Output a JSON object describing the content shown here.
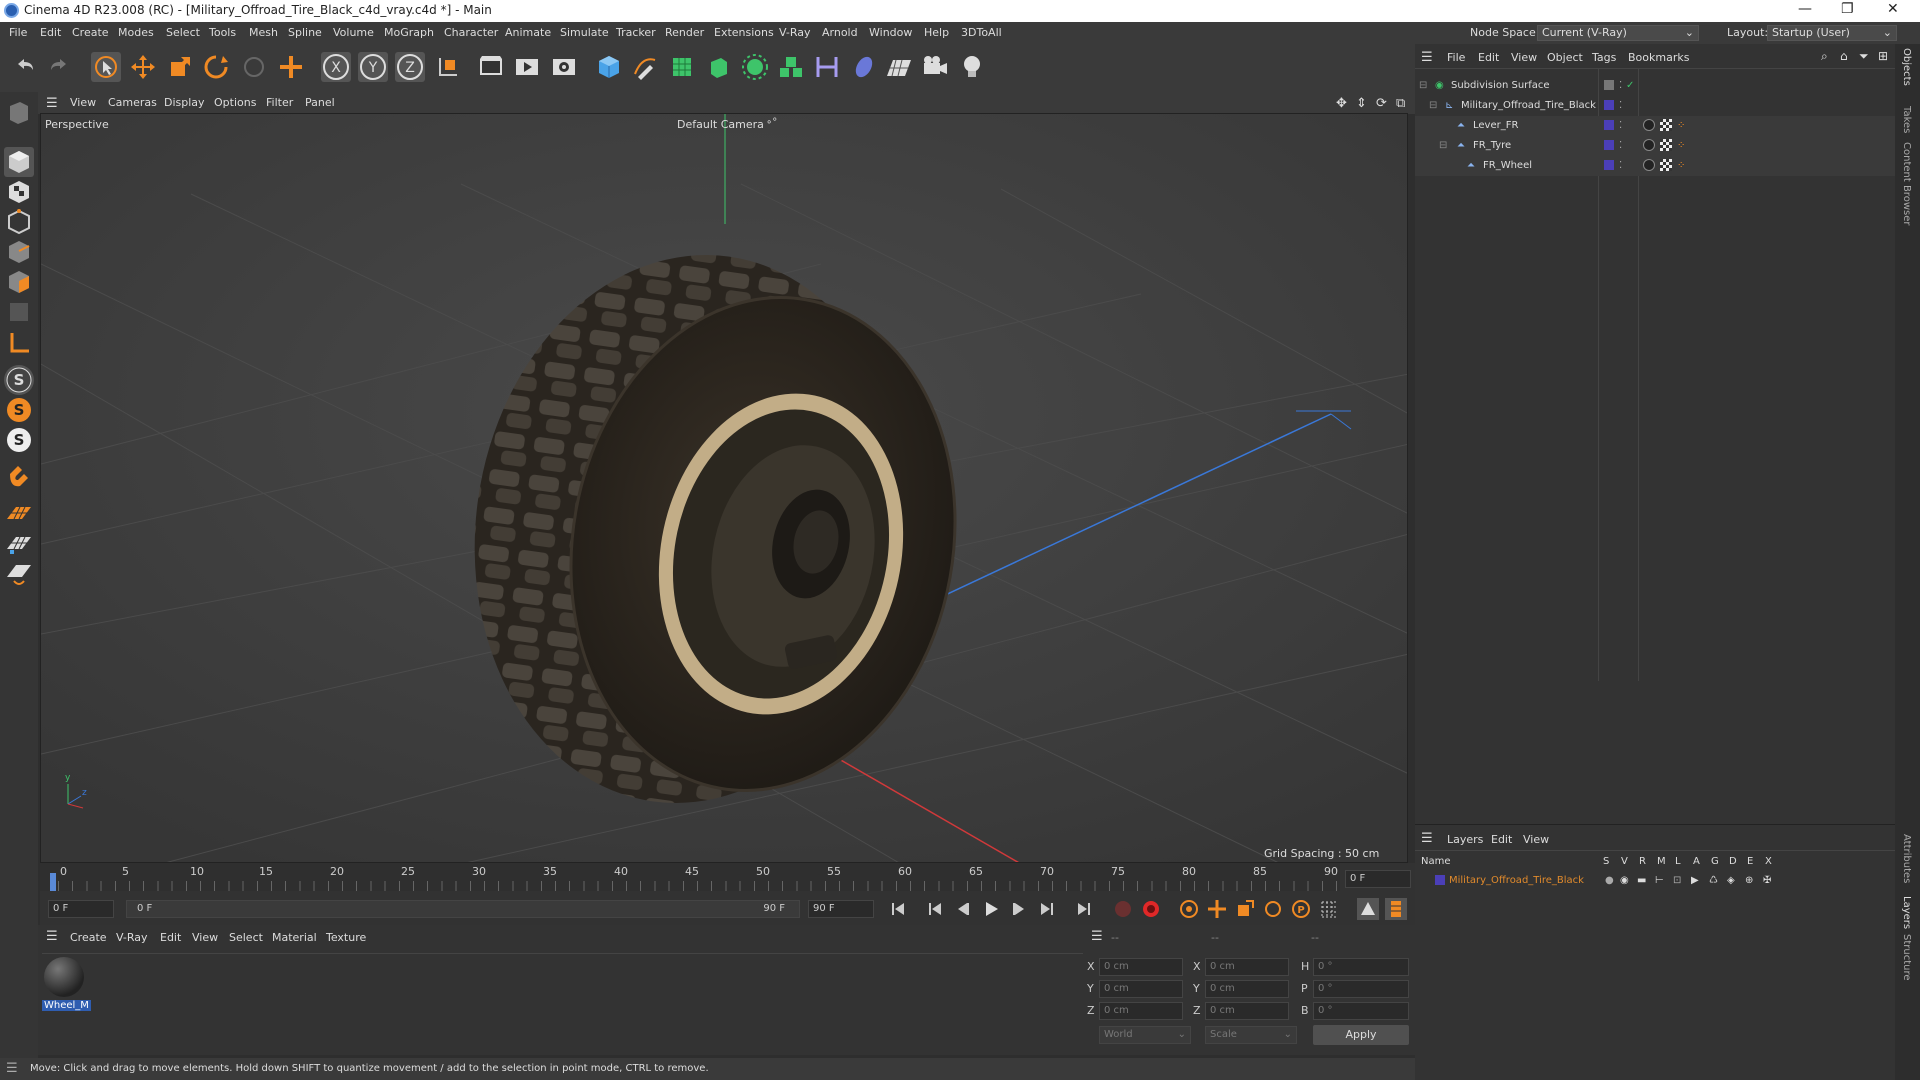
{
  "titlebar": {
    "title": "Cinema 4D R23.008 (RC) - [Military_Offroad_Tire_Black_c4d_vray.c4d *] - Main"
  },
  "menu": [
    "File",
    "Edit",
    "Create",
    "Modes",
    "Select",
    "Tools",
    "Mesh",
    "Spline",
    "Volume",
    "MoGraph",
    "Character",
    "Animate",
    "Simulate",
    "Tracker",
    "Render",
    "Extensions",
    "V-Ray",
    "Arnold",
    "Window",
    "Help",
    "3DToAll"
  ],
  "nodespace": {
    "label": "Node Space:",
    "value": "Current (V-Ray)"
  },
  "layout": {
    "label": "Layout:",
    "value": "Startup (User)"
  },
  "viewport_menu": [
    "View",
    "Cameras",
    "Display",
    "Options",
    "Filter",
    "Panel"
  ],
  "viewport": {
    "name": "Perspective",
    "camera": "Default Camera",
    "grid_spacing": "Grid Spacing : 50 cm"
  },
  "timeline": {
    "ticks": [
      "0",
      "5",
      "10",
      "15",
      "20",
      "25",
      "30",
      "35",
      "40",
      "45",
      "50",
      "55",
      "60",
      "65",
      "70",
      "75",
      "80",
      "85",
      "90"
    ],
    "current_frame": "0 F",
    "start": "0 F",
    "range_start": "0 F",
    "range_end": "90 F",
    "end": "90 F"
  },
  "material_menu": [
    "Create",
    "V-Ray",
    "Edit",
    "View",
    "Select",
    "Material",
    "Texture"
  ],
  "materials": [
    {
      "name": "Wheel_M"
    }
  ],
  "coords": {
    "headers": [
      "--",
      "--",
      "--"
    ],
    "rows": [
      {
        "a": "X",
        "av": "0 cm",
        "b": "X",
        "bv": "0 cm",
        "c": "H",
        "cv": "0 °"
      },
      {
        "a": "Y",
        "av": "0 cm",
        "b": "Y",
        "bv": "0 cm",
        "c": "P",
        "cv": "0 °"
      },
      {
        "a": "Z",
        "av": "0 cm",
        "b": "Z",
        "bv": "0 cm",
        "c": "B",
        "cv": "0 °"
      }
    ],
    "world": "World",
    "scale": "Scale",
    "apply": "Apply"
  },
  "status": "Move: Click and drag to move elements. Hold down SHIFT to quantize movement / add to the selection in point mode, CTRL to remove.",
  "objects_menu": [
    "File",
    "Edit",
    "View",
    "Object",
    "Tags",
    "Bookmarks"
  ],
  "objects": [
    {
      "name": "Subdivision Surface",
      "indent": 0
    },
    {
      "name": "Military_Offroad_Tire_Black",
      "indent": 1
    },
    {
      "name": "Lever_FR",
      "indent": 2
    },
    {
      "name": "FR_Tyre",
      "indent": 2
    },
    {
      "name": "FR_Wheel",
      "indent": 3
    }
  ],
  "layers_menu": [
    "Layers",
    "Edit",
    "View"
  ],
  "layers": {
    "name_header": "Name",
    "cols": [
      "S",
      "V",
      "R",
      "M",
      "L",
      "A",
      "G",
      "D",
      "E",
      "X"
    ],
    "items": [
      {
        "name": "Military_Offroad_Tire_Black",
        "color": "#4b3fb8"
      }
    ]
  },
  "right_tabs": [
    "Objects",
    "Takes",
    "Content Browser"
  ],
  "right_tabs_lower": [
    "Attributes",
    "Layers",
    "Structure"
  ],
  "colors": {
    "accent": "#f08a24",
    "layer_text": "#e08a2c",
    "axis_y": "#3ec46a",
    "axis_x": "#d0393a",
    "axis_z": "#3a78d8"
  }
}
